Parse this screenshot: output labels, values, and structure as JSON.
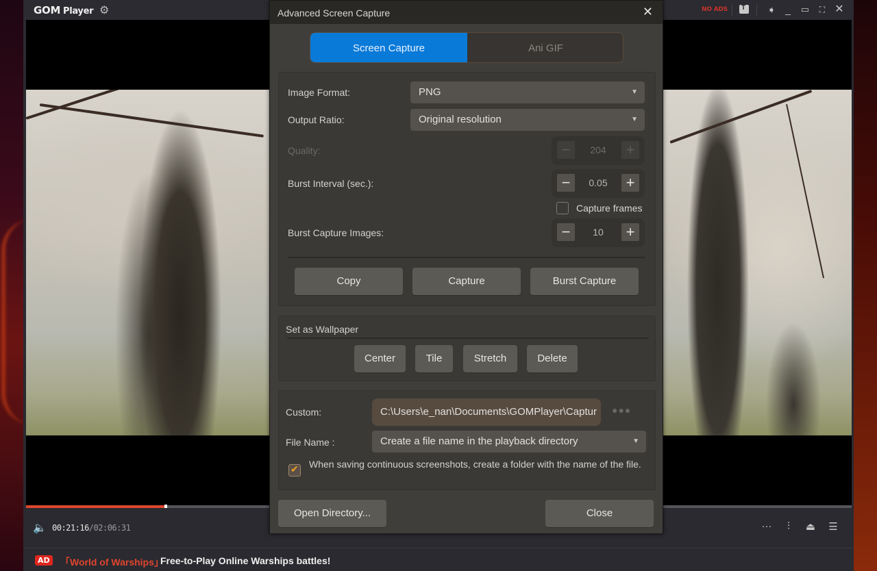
{
  "player": {
    "logo_gom": "GOM",
    "logo_player": "Player",
    "no_ads": "NO ADS",
    "current_time": "00:21:16",
    "total_time": "/02:06:31",
    "progress": 0.168,
    "ad_badge": "AD",
    "ad_title": "「World of Warships」",
    "ad_text": "Free-to-Play Online Warships battles!"
  },
  "dialog": {
    "title": "Advanced Screen Capture",
    "tabs": [
      {
        "label": "Screen Capture",
        "active": true
      },
      {
        "label": "Ani GIF",
        "active": false
      }
    ],
    "image_format": {
      "label": "Image Format:",
      "value": "PNG"
    },
    "output_ratio": {
      "label": "Output Ratio:",
      "value": "Original resolution"
    },
    "quality": {
      "label": "Quality:",
      "value": "204",
      "disabled": true
    },
    "burst_interval": {
      "label": "Burst Interval (sec.):",
      "value": "0.05"
    },
    "capture_frames": {
      "label": "Capture frames",
      "checked": false
    },
    "burst_images": {
      "label": "Burst Capture Images:",
      "value": "10"
    },
    "actions": {
      "copy": "Copy",
      "capture": "Capture",
      "burst_capture": "Burst Capture"
    },
    "wallpaper": {
      "title": "Set as Wallpaper",
      "center": "Center",
      "tile": "Tile",
      "stretch": "Stretch",
      "delete": "Delete"
    },
    "custom": {
      "label": "Custom:",
      "value": "C:\\Users\\e_nan\\Documents\\GOMPlayer\\Captur",
      "more": "●●●"
    },
    "file_name": {
      "label": "File Name :",
      "value": "Create a file name in the playback directory"
    },
    "folder_option": {
      "label": "When saving continuous screenshots, create a folder with the name of the file.",
      "checked": true
    },
    "open_directory": "Open Directory...",
    "close": "Close"
  },
  "colors": {
    "accent": "#0a7ad8",
    "progress": "#e0452e",
    "ad_red": "#e0261e",
    "checkbox_check": "#f0a020"
  }
}
